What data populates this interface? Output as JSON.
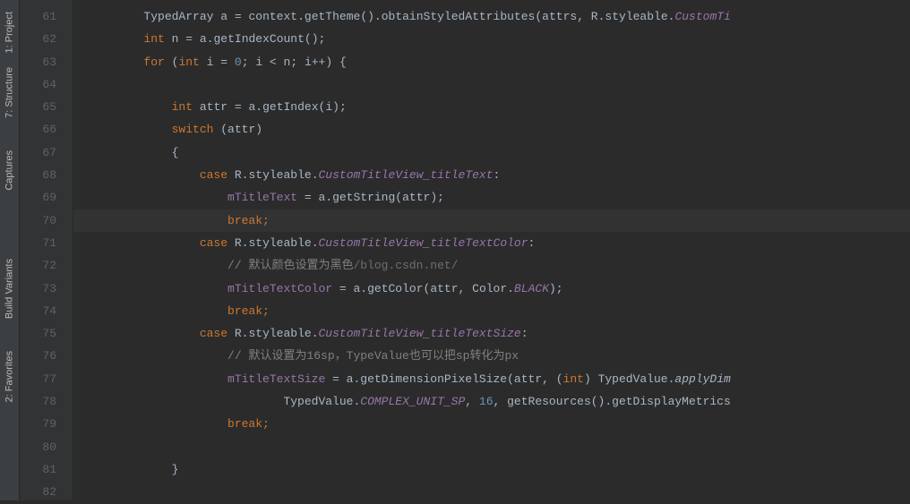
{
  "tool_windows": [
    {
      "label": "1: Project",
      "icon": "project"
    },
    {
      "label": "7: Structure",
      "icon": "structure"
    },
    {
      "label": "Captures",
      "icon": "captures"
    },
    {
      "label": "Build Variants",
      "icon": "build-variants"
    },
    {
      "label": "2: Favorites",
      "icon": "favorites"
    }
  ],
  "lines": {
    "start": 61,
    "end": 82
  },
  "code": {
    "l61_indent": "        ",
    "l61_class": "TypedArray ",
    "l61_var": "a ",
    "l61_eq": "= ",
    "l61_ctx": "context",
    "l61_dot1": ".",
    "l61_m1": "getTheme",
    "l61_p1": "().",
    "l61_m2": "obtainStyledAttributes",
    "l61_p2": "(",
    "l61_a1": "attrs",
    "l61_c1": ", ",
    "l61_r": "R",
    "l61_dot2": ".",
    "l61_sty": "styleable",
    "l61_dot3": ".",
    "l61_ct": "CustomTi",
    "l62_indent": "        ",
    "l62_kw": "int ",
    "l62_var": "n ",
    "l62_eq": "= ",
    "l62_a": "a",
    "l62_dot": ".",
    "l62_m": "getIndexCount",
    "l62_p": "();",
    "l63_indent": "        ",
    "l63_for": "for ",
    "l63_p1": "(",
    "l63_int": "int ",
    "l63_i": "i ",
    "l63_eq": "= ",
    "l63_zero": "0",
    "l63_sc1": "; ",
    "l63_cond": "i < n",
    "l63_sc2": "; ",
    "l63_inc": "i++",
    "l63_p2": ") {",
    "l65_indent": "            ",
    "l65_kw": "int ",
    "l65_var": "attr ",
    "l65_eq": "= ",
    "l65_a": "a",
    "l65_dot": ".",
    "l65_m": "getIndex",
    "l65_p1": "(",
    "l65_arg": "i",
    "l65_p2": ");",
    "l66_indent": "            ",
    "l66_kw": "switch ",
    "l66_p": "(attr)",
    "l67_indent": "            ",
    "l67_b": "{",
    "l68_indent": "                ",
    "l68_kw": "case ",
    "l68_r": "R",
    "l68_dot1": ".",
    "l68_sty": "styleable",
    "l68_dot2": ".",
    "l68_f": "CustomTitleView_titleText",
    "l68_c": ":",
    "l69_indent": "                    ",
    "l69_f": "mTitleText",
    "l69_eq": " = ",
    "l69_a": "a",
    "l69_dot": ".",
    "l69_m": "getString",
    "l69_p1": "(",
    "l69_arg": "attr",
    "l69_p2": ");",
    "l70_indent": "                    ",
    "l70_kw": "break;",
    "l71_indent": "                ",
    "l71_kw": "case ",
    "l71_r": "R",
    "l71_dot1": ".",
    "l71_sty": "styleable",
    "l71_dot2": ".",
    "l71_f": "CustomTitleView_titleTextColor",
    "l71_c": ":",
    "l72_indent": "                    ",
    "l72_c1": "// ",
    "l72_c2": "默认颜色设置为黑色",
    "l72_wm": "/blog.csdn.net/",
    "l73_indent": "                    ",
    "l73_f": "mTitleTextColor",
    "l73_eq": " = ",
    "l73_a": "a",
    "l73_dot": ".",
    "l73_m": "getColor",
    "l73_p1": "(",
    "l73_arg": "attr",
    "l73_c1": ", ",
    "l73_col": "Color",
    "l73_dot2": ".",
    "l73_bl": "BLACK",
    "l73_p2": ");",
    "l74_indent": "                    ",
    "l74_kw": "break;",
    "l75_indent": "                ",
    "l75_kw": "case ",
    "l75_r": "R",
    "l75_dot1": ".",
    "l75_sty": "styleable",
    "l75_dot2": ".",
    "l75_f": "CustomTitleView_titleTextSize",
    "l75_c": ":",
    "l76_indent": "                    ",
    "l76_c": "// 默认设置为16sp，TypeValue也可以把sp转化为px",
    "l77_indent": "                    ",
    "l77_f": "mTitleTextSize",
    "l77_eq": " = ",
    "l77_a": "a",
    "l77_dot": ".",
    "l77_m": "getDimensionPixelSize",
    "l77_p1": "(",
    "l77_arg": "attr",
    "l77_c1": ", (",
    "l77_kw": "int",
    "l77_p2": ") ",
    "l77_tv": "TypedValue",
    "l77_dot2": ".",
    "l77_ad": "applyDim",
    "l78_indent": "                            ",
    "l78_tv": "TypedValue",
    "l78_dot": ".",
    "l78_cu": "COMPLEX_UNIT_SP",
    "l78_c1": ", ",
    "l78_n": "16",
    "l78_c2": ", ",
    "l78_m": "getResources",
    "l78_p1": "().",
    "l78_m2": "getDisplayMetrics",
    "l79_indent": "                    ",
    "l79_kw": "break;",
    "l81_indent": "            ",
    "l81_b": "}"
  }
}
